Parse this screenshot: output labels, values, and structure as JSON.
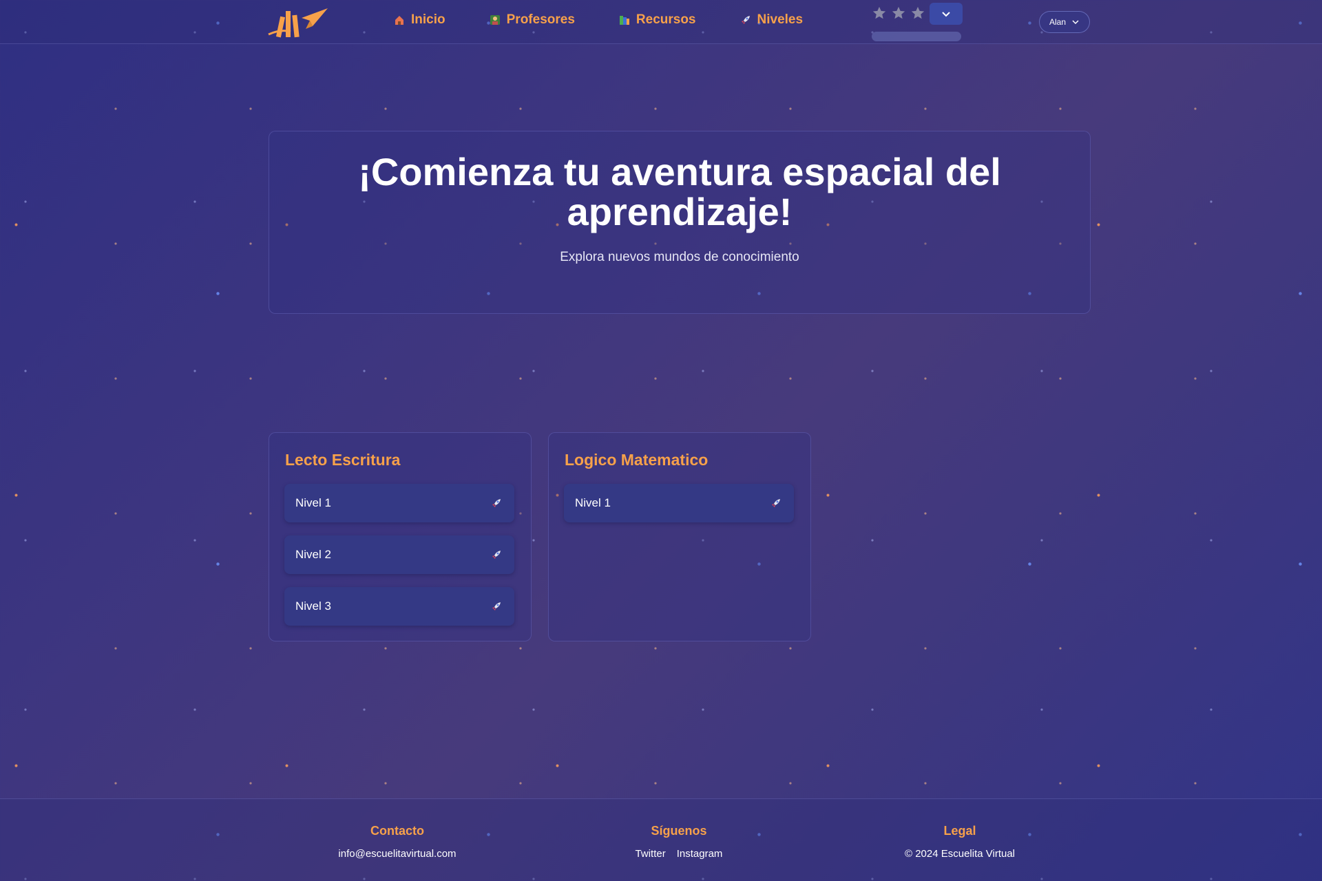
{
  "colors": {
    "accent": "#f7a14a",
    "background": "#3a3683",
    "card_item": "#343985",
    "toggle": "#3b4aa6"
  },
  "header": {
    "logo_icon": "paper-plane-books-logo",
    "nav": [
      {
        "label": "Inicio",
        "icon": "house-icon"
      },
      {
        "label": "Profesores",
        "icon": "teacher-icon"
      },
      {
        "label": "Recursos",
        "icon": "books-icon"
      },
      {
        "label": "Niveles",
        "icon": "rocket-icon"
      }
    ],
    "rating": {
      "stars_total": 3,
      "stars_filled": 0,
      "progress": 0
    },
    "user": {
      "name": "Alan"
    }
  },
  "hero": {
    "title": "¡Comienza tu aventura espacial del aprendizaje!",
    "subtitle": "Explora nuevos mundos de conocimiento"
  },
  "subjects": [
    {
      "title": "Lecto Escritura",
      "levels": [
        "Nivel 1",
        "Nivel 2",
        "Nivel 3"
      ]
    },
    {
      "title": "Logico Matematico",
      "levels": [
        "Nivel 1"
      ]
    }
  ],
  "footer": {
    "contacto": {
      "heading": "Contacto",
      "email": "info@escuelitavirtual.com"
    },
    "siguenos": {
      "heading": "Síguenos",
      "links": [
        "Twitter",
        "Instagram"
      ]
    },
    "legal": {
      "heading": "Legal",
      "text": "© 2024 Escuelita Virtual"
    }
  }
}
